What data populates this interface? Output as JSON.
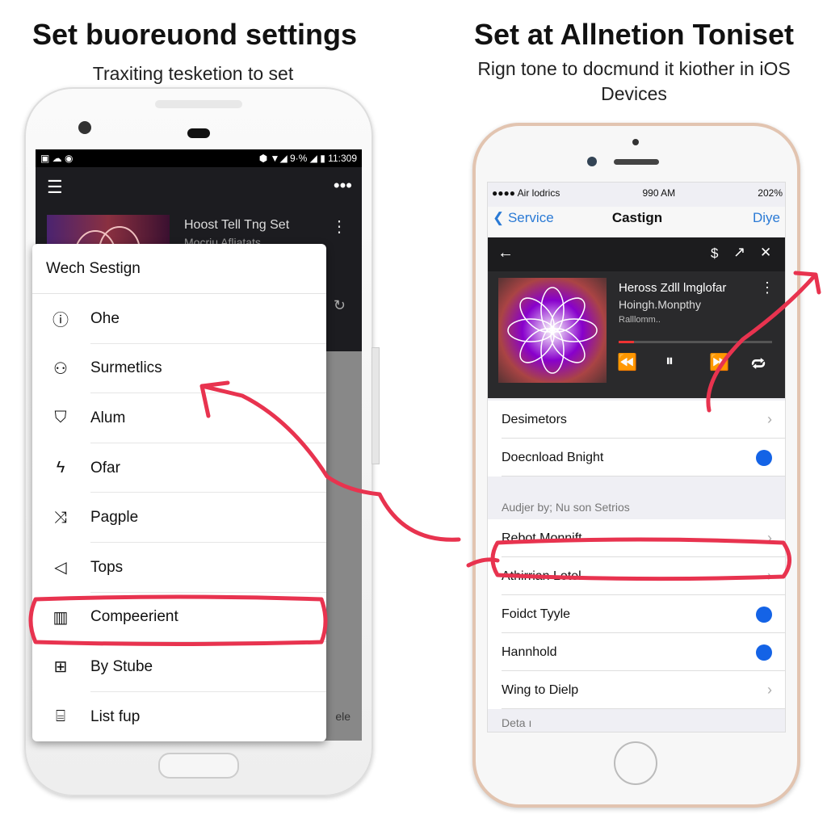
{
  "left": {
    "title": "Set buoreuond settings",
    "subtitle": "Traxiting tesketion to set",
    "status": {
      "left_icons": "▣ ☁ ◉",
      "right": "⬢ ▼◢ 9·% ◢ ▮ 11:309"
    },
    "track": {
      "title": "Hoost Tell Tng Set",
      "artist": "Mocriu Afliatats"
    },
    "side_text": "ele",
    "menu": {
      "header": "Wech Sestign",
      "items": [
        {
          "icon": "info-icon",
          "glyph": "ⓘ",
          "label": "Ohe"
        },
        {
          "icon": "person-icon",
          "glyph": "⚇",
          "label": "Surmetlics"
        },
        {
          "icon": "shield-icon",
          "glyph": "⛉",
          "label": "Alum"
        },
        {
          "icon": "bolt-icon",
          "glyph": "ϟ",
          "label": "Ofar"
        },
        {
          "icon": "shuffle-icon",
          "glyph": "⤨",
          "label": "Pagple"
        },
        {
          "icon": "send-icon",
          "glyph": "◁",
          "label": "Tops"
        },
        {
          "icon": "equalizer-icon",
          "glyph": "▥",
          "label": "Compeerient"
        },
        {
          "icon": "plus-box-icon",
          "glyph": "⊞",
          "label": "By Stube"
        },
        {
          "icon": "list-icon",
          "glyph": "⌸",
          "label": "List fup"
        }
      ]
    }
  },
  "right": {
    "title": "Set at Allnetion Toniset",
    "subtitle": "Rign tone to docmund it kiother in iOS Devices",
    "status": {
      "carrier": "●●●● Air lodrics",
      "time": "990 AM",
      "battery": "202%"
    },
    "nav": {
      "back": "Service",
      "title": "Castign",
      "action": "Diye"
    },
    "player": {
      "title": "Heross Zdll lmglofar",
      "artist": "Hoingh.Monpthy",
      "album": "Ralllomm..",
      "progress": 0.1
    },
    "rows1": [
      {
        "label": "Desimetors",
        "type": "chevron"
      },
      {
        "label": "Doecnload Bnight",
        "type": "dot"
      }
    ],
    "section": "Audjer by; Nu son Setrios",
    "rows2": [
      {
        "label": "Rebot Monnift",
        "type": "chevron"
      },
      {
        "label": "Athirrian Lotel",
        "type": "chevron"
      },
      {
        "label": "Foidct Tyyle",
        "type": "dot"
      },
      {
        "label": "Hannhold",
        "type": "dot"
      },
      {
        "label": "Wing to Dielp",
        "type": "chevron"
      }
    ],
    "footer": "Deta ı"
  },
  "colors": {
    "annotation": "#e8334f",
    "ios_blue": "#1463e6",
    "link": "#2a7ad5"
  }
}
